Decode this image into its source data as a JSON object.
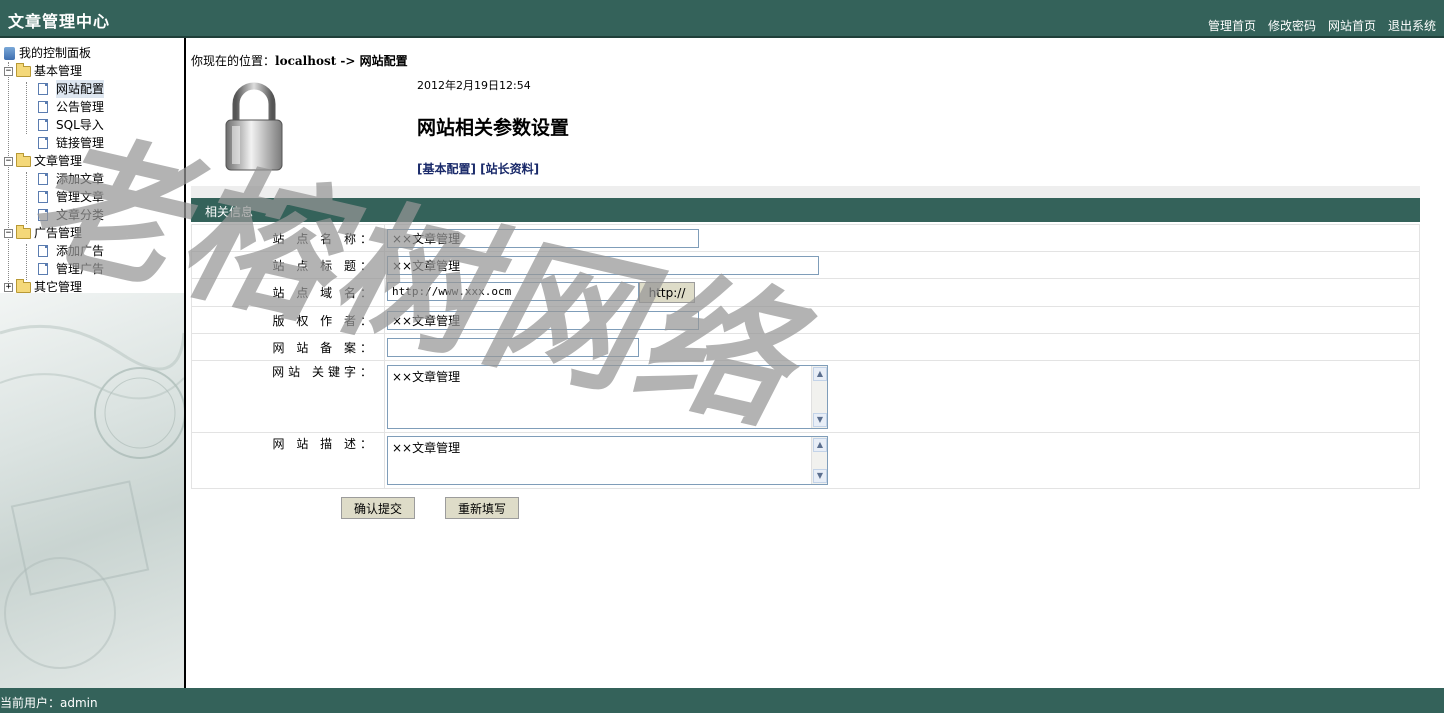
{
  "header": {
    "title": "文章管理中心",
    "nav": [
      "管理首页",
      "修改密码",
      "网站首页",
      "退出系统"
    ]
  },
  "sidebar": {
    "root": "我的控制面板",
    "groups": [
      {
        "label": "基本管理",
        "expanded": true,
        "items": [
          "网站配置",
          "公告管理",
          "SQL导入",
          "链接管理"
        ]
      },
      {
        "label": "文章管理",
        "expanded": true,
        "items": [
          "添加文章",
          "管理文章",
          "文章分类"
        ]
      },
      {
        "label": "广告管理",
        "expanded": true,
        "items": [
          "添加广告",
          "管理广告"
        ]
      },
      {
        "label": "其它管理",
        "expanded": false,
        "items": []
      }
    ],
    "selected": "网站配置"
  },
  "content": {
    "breadcrumb_prefix": "你现在的位置：",
    "breadcrumb_path": "localhost -> 网站配置",
    "date": "2012年2月19日12:54",
    "heading": "网站相关参数设置",
    "links": [
      "[基本配置]",
      "[站长资料]"
    ],
    "section_title": "相关信息",
    "fields": {
      "site_name": {
        "label": "站 点 名 称：",
        "value": "××文章管理"
      },
      "site_title": {
        "label": "站 点 标 题：",
        "value": "××文章管理"
      },
      "site_domain": {
        "label": "站 点 域 名：",
        "value": "http://www.xxx.ocm",
        "button": "http://"
      },
      "copyright": {
        "label": "版 权 作 者：",
        "value": "××文章管理"
      },
      "icp": {
        "label": "网 站 备 案：",
        "value": ""
      },
      "keywords": {
        "label": "网站 关键字：",
        "value": "××文章管理"
      },
      "description": {
        "label": "网 站 描 述：",
        "value": "××文章管理"
      }
    },
    "submit_label": "确认提交",
    "reset_label": "重新填写"
  },
  "footer": {
    "user_text": "当前用户：admin"
  },
  "watermark": "老榕树网络",
  "colors": {
    "brand": "#34625a",
    "button": "#dedcc8",
    "input_border": "#7f9db9"
  }
}
